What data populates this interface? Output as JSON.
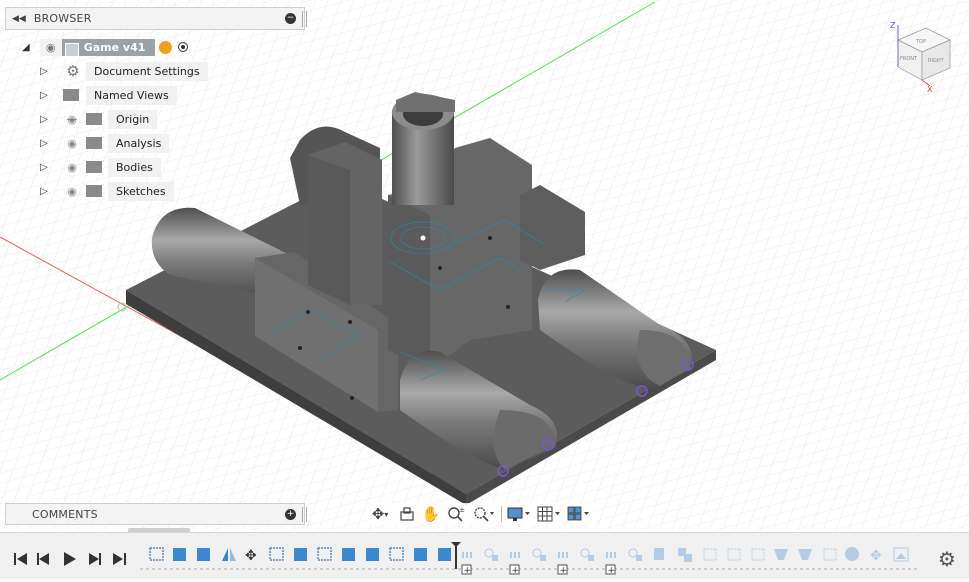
{
  "browser": {
    "title": "BROWSER",
    "root": {
      "label": "Game v41"
    },
    "items": [
      {
        "label": "Document Settings",
        "icon": "gear-icon",
        "visibility": "none"
      },
      {
        "label": "Named Views",
        "icon": "folder-icon",
        "visibility": "none"
      },
      {
        "label": "Origin",
        "icon": "folder-icon",
        "visibility": "hidden"
      },
      {
        "label": "Analysis",
        "icon": "folder-icon",
        "visibility": "visible"
      },
      {
        "label": "Bodies",
        "icon": "folder-icon",
        "visibility": "visible"
      },
      {
        "label": "Sketches",
        "icon": "folder-icon",
        "visibility": "visible"
      }
    ]
  },
  "comments": {
    "title": "COMMENTS"
  },
  "viewcube": {
    "top": "TOP",
    "front": "FRONT",
    "right": "RIGHT",
    "axis_z": "Z",
    "axis_x": "X"
  },
  "nav_toolbar": {
    "tools": [
      "orbit-icon",
      "look-at-icon",
      "pan-icon",
      "zoom-icon",
      "fit-icon",
      "display-settings-icon",
      "grid-icon",
      "viewports-icon"
    ]
  },
  "timeline": {
    "controls": [
      "first-icon",
      "previous-icon",
      "play-icon",
      "next-icon",
      "last-icon"
    ],
    "features": [
      "sketch",
      "extrude",
      "extrude",
      "mirror",
      "move",
      "sketch",
      "extrude",
      "sketch",
      "extrude",
      "extrude",
      "sketch",
      "extrude",
      "extrude",
      "joint",
      "joint",
      "joint",
      "joint",
      "joint",
      "joint",
      "joint",
      "joint",
      "sketch",
      "sketch",
      "sketch",
      "plane",
      "plane",
      "sketch",
      "sphere",
      "move",
      "image"
    ]
  },
  "colors": {
    "accent": "#f0a020",
    "model": "#6b6b6b",
    "grid": "#dedede",
    "axis_red": "#e05050",
    "axis_green": "#50d050",
    "panel": "#f3f3f3"
  }
}
